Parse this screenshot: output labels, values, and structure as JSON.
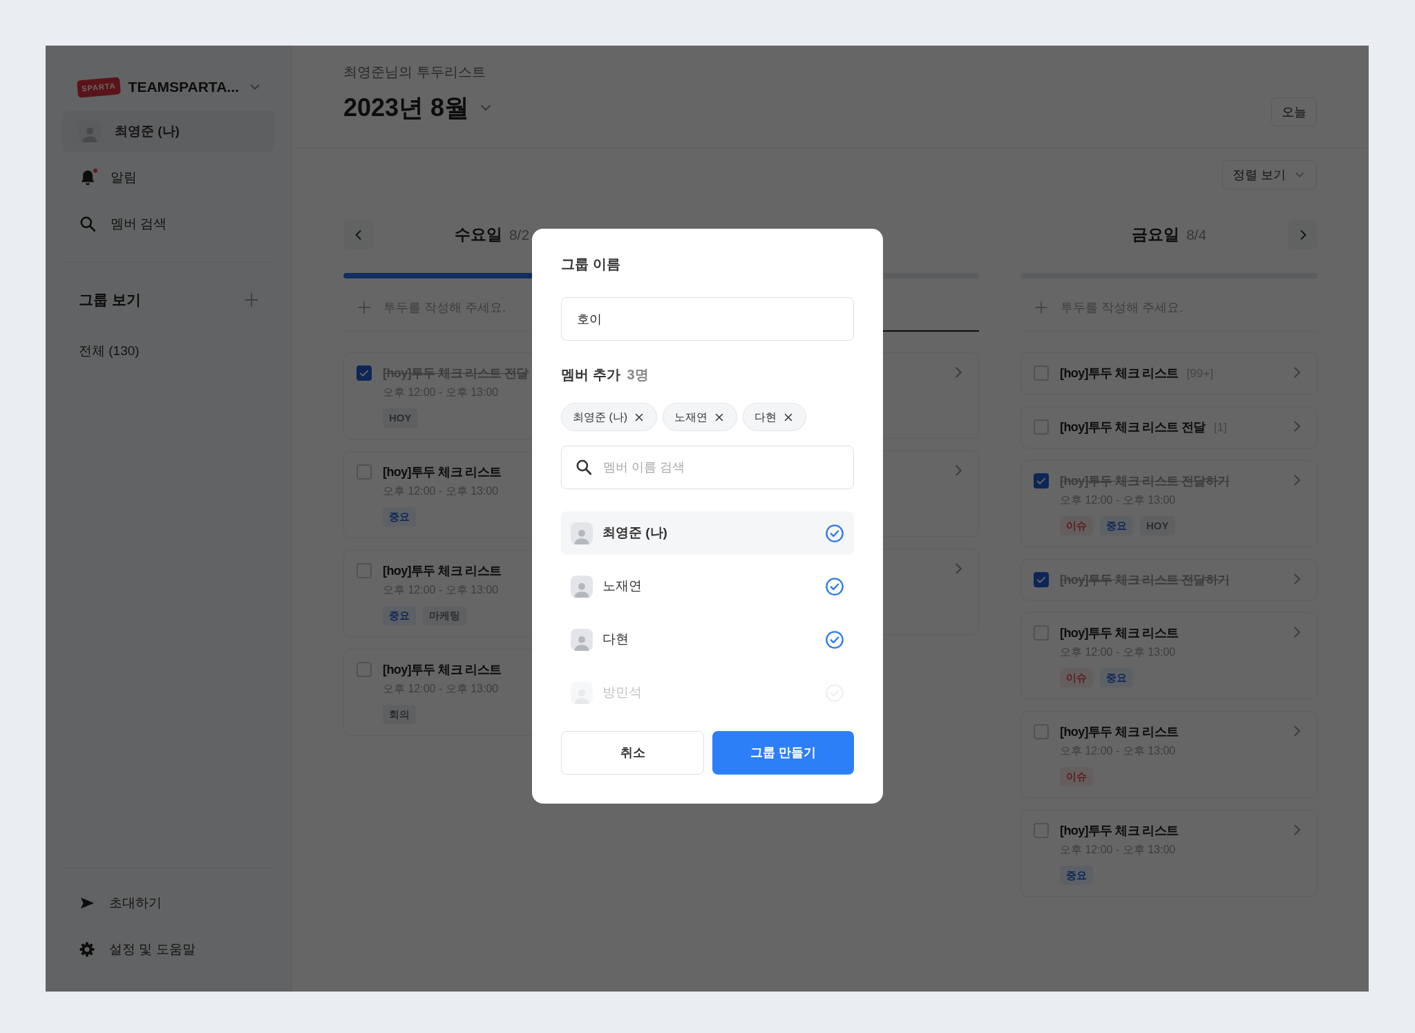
{
  "sidebar": {
    "logo_text": "SPARTA",
    "workspace": "TEAMSPARTA...",
    "items": [
      {
        "kind": "profile",
        "label": "최영준 (나)",
        "selected": true,
        "unread": false
      },
      {
        "kind": "bell",
        "label": "알림",
        "selected": false,
        "unread": true
      },
      {
        "kind": "search",
        "label": "멤버 검색",
        "selected": false,
        "unread": false
      }
    ],
    "groups_title": "그룹 보기",
    "groups": [
      {
        "label": "전체 (130)"
      }
    ],
    "footer": [
      {
        "kind": "invite",
        "label": "초대하기"
      },
      {
        "kind": "settings",
        "label": "설정 및 도움말"
      }
    ]
  },
  "header": {
    "subtitle": "최영준님의 투두리스트",
    "month": "2023년 8월",
    "today_button": "오늘",
    "sort_button": "정렬 보기"
  },
  "columns": [
    {
      "day": "수요일",
      "date": "8/2",
      "prev_button": true,
      "next_button": false,
      "level": 1,
      "add_placeholder": "투두를 작성해 주세요.",
      "focused": false,
      "todos": [
        {
          "title": "[hoy]투두 체크 리스트 전달",
          "done": true,
          "time": "오후 12:00 - 오후 13:00",
          "tags": [
            {
              "label": "HOY",
              "kind": "neutral"
            }
          ],
          "chevron": false
        },
        {
          "title": "[hoy]투두 체크 리스트",
          "done": false,
          "time": "오후 12:00 - 오후 13:00",
          "tags": [
            {
              "label": "중요",
              "kind": "primary"
            }
          ],
          "chevron": false
        },
        {
          "title": "[hoy]투두 체크 리스트",
          "done": false,
          "time": "오후 12:00 - 오후 13:00",
          "tags": [
            {
              "label": "중요",
              "kind": "primary"
            },
            {
              "label": "마케팅",
              "kind": "neutral"
            }
          ],
          "chevron": false
        },
        {
          "title": "[hoy]투두 체크 리스트",
          "done": false,
          "time": "오후 12:00 - 오후 13:00",
          "tags": [
            {
              "label": "회의",
              "kind": "neutral"
            }
          ],
          "chevron": false
        }
      ]
    },
    {
      "prev_button": false,
      "next_button": false,
      "level": 0,
      "focused": true,
      "todos": [
        {
          "chevron": true
        },
        {
          "chevron": true
        },
        {
          "chevron": true
        }
      ]
    },
    {
      "day": "금요일",
      "date": "8/4",
      "prev_button": false,
      "next_button": true,
      "level": 0,
      "add_placeholder": "투두를 작성해 주세요.",
      "focused": false,
      "todos": [
        {
          "title": "[hoy]투두 체크 리스트",
          "count": "[99+]",
          "done": false,
          "chevron": true
        },
        {
          "title": "[hoy]투두 체크 리스트 전달",
          "count": "[1]",
          "done": false,
          "chevron": true
        },
        {
          "title": "[hoy]투두 체크 리스트 전달하기",
          "done": true,
          "time": "오후 12:00 - 오후 13:00",
          "tags": [
            {
              "label": "이슈",
              "kind": "danger"
            },
            {
              "label": "중요",
              "kind": "primary"
            },
            {
              "label": "HOY",
              "kind": "neutral"
            }
          ],
          "chevron": true
        },
        {
          "title": "[hoy]투두 체크 리스트 전달하기",
          "done": true,
          "chevron": true
        },
        {
          "title": "[hoy]투두 체크 리스트",
          "done": false,
          "time": "오후 12:00 - 오후 13:00",
          "tags": [
            {
              "label": "이슈",
              "kind": "danger"
            },
            {
              "label": "중요",
              "kind": "primary"
            }
          ],
          "chevron": true
        },
        {
          "title": "[hoy]투두 체크 리스트",
          "done": false,
          "time": "오후 12:00 - 오후 13:00",
          "tags": [
            {
              "label": "이슈",
              "kind": "danger"
            }
          ],
          "chevron": true
        },
        {
          "title": "[hoy]투두 체크 리스트",
          "done": false,
          "time": "오후 12:00 - 오후 13:00",
          "tags": [
            {
              "label": "중요",
              "kind": "primary"
            }
          ],
          "chevron": true
        }
      ]
    }
  ],
  "modal": {
    "name_label": "그룹 이름",
    "name_value": "호이",
    "members_label": "멤버 추가",
    "members_count": "3명",
    "chips": [
      {
        "label": "최영준 (나)"
      },
      {
        "label": "노재연"
      },
      {
        "label": "다현"
      }
    ],
    "search_placeholder": "멤버 이름 검색",
    "members": [
      {
        "name": "최영준 (나)",
        "checked": true,
        "highlighted": true,
        "faded": false
      },
      {
        "name": "노재연",
        "checked": true,
        "highlighted": false,
        "faded": false
      },
      {
        "name": "다현",
        "checked": true,
        "highlighted": false,
        "faded": false
      },
      {
        "name": "방민석",
        "checked": false,
        "highlighted": false,
        "faded": true
      }
    ],
    "cancel": "취소",
    "confirm": "그룹 만들기"
  }
}
